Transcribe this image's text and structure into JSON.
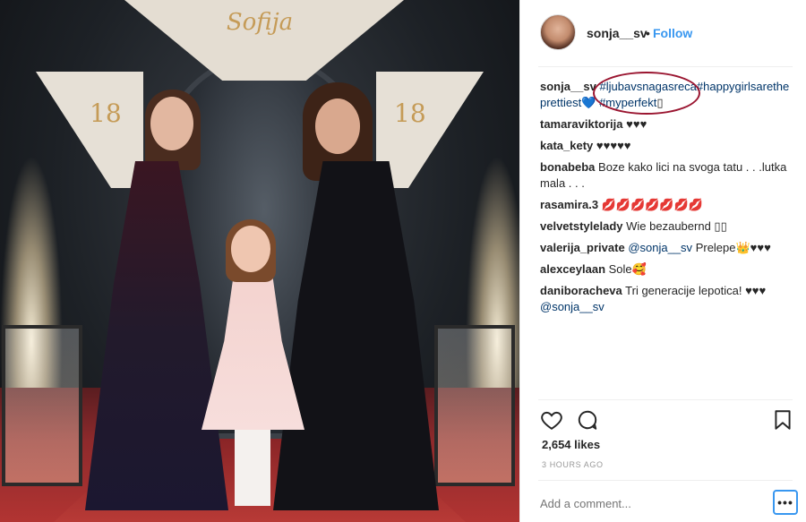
{
  "photo": {
    "logo_text": "Sofija",
    "number_left": "18",
    "number_right": "18"
  },
  "header": {
    "username": "sonja__sv",
    "separator": "•",
    "follow_label": "Follow"
  },
  "caption": {
    "user": "sonja__sv",
    "hashtag1": "#ljubavsnagasreca",
    "hashtag2": "#happygirlsarethe prettiest",
    "heart": "💙",
    "hashtag3": "#myperfekt",
    "trailing": "▯"
  },
  "comments": [
    {
      "user": "tamaraviktorija",
      "text": "♥♥♥"
    },
    {
      "user": "kata_kety",
      "text": "♥♥♥♥♥"
    },
    {
      "user": "bonabeba",
      "text": "Boze kako lici na svoga tatu . . .lutka mala . . ."
    },
    {
      "user": "rasamira.3",
      "text": "💋💋💋💋💋💋💋"
    },
    {
      "user": "velvetstylelady",
      "text": "Wie bezaubernd ▯▯"
    },
    {
      "user": "valerija_private",
      "mention": "@sonja__sv",
      "text": "Prelepe👑♥♥♥"
    },
    {
      "user": "alexceylaan",
      "text": "Sole🥰"
    },
    {
      "user": "daniboracheva",
      "text": "Tri generacije lepotica! ♥♥♥",
      "mention_after": "@sonja__sv"
    }
  ],
  "likes": {
    "label": "2,654 likes"
  },
  "time_ago": "3 HOURS AGO",
  "add_comment": {
    "placeholder": "Add a comment..."
  },
  "more_label": "•••",
  "colors": {
    "accent": "#3897f0",
    "hashtag": "#003569",
    "highlight": "#9a1530"
  }
}
